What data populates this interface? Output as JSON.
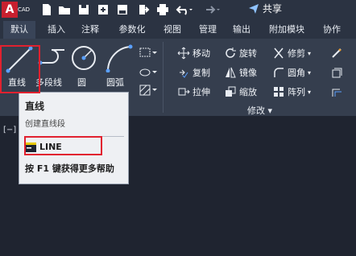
{
  "app": {
    "logo_letter": "A",
    "logo_sub": "CAD",
    "share_label": "共享"
  },
  "tabs": [
    "默认",
    "插入",
    "注释",
    "参数化",
    "视图",
    "管理",
    "输出",
    "附加模块",
    "协作"
  ],
  "draw_tools": {
    "line": "直线",
    "polyline": "多段线",
    "circle": "圆",
    "arc": "圆弧"
  },
  "modify": {
    "move": "移动",
    "rotate": "旋转",
    "trim": "修剪",
    "copy": "复制",
    "mirror": "镜像",
    "fillet": "圆角",
    "stretch": "拉伸",
    "scale": "缩放",
    "array": "阵列",
    "panel_title": "修改"
  },
  "tooltip": {
    "title": "直线",
    "description": "创建直线段",
    "command": "LINE",
    "help": "按 F1 键获得更多帮助"
  },
  "viewport": {
    "label": "[−]"
  },
  "colors": {
    "accent_red": "#e1212f",
    "ribbon_bg": "#353e4e",
    "canvas_bg": "#1f2430"
  }
}
